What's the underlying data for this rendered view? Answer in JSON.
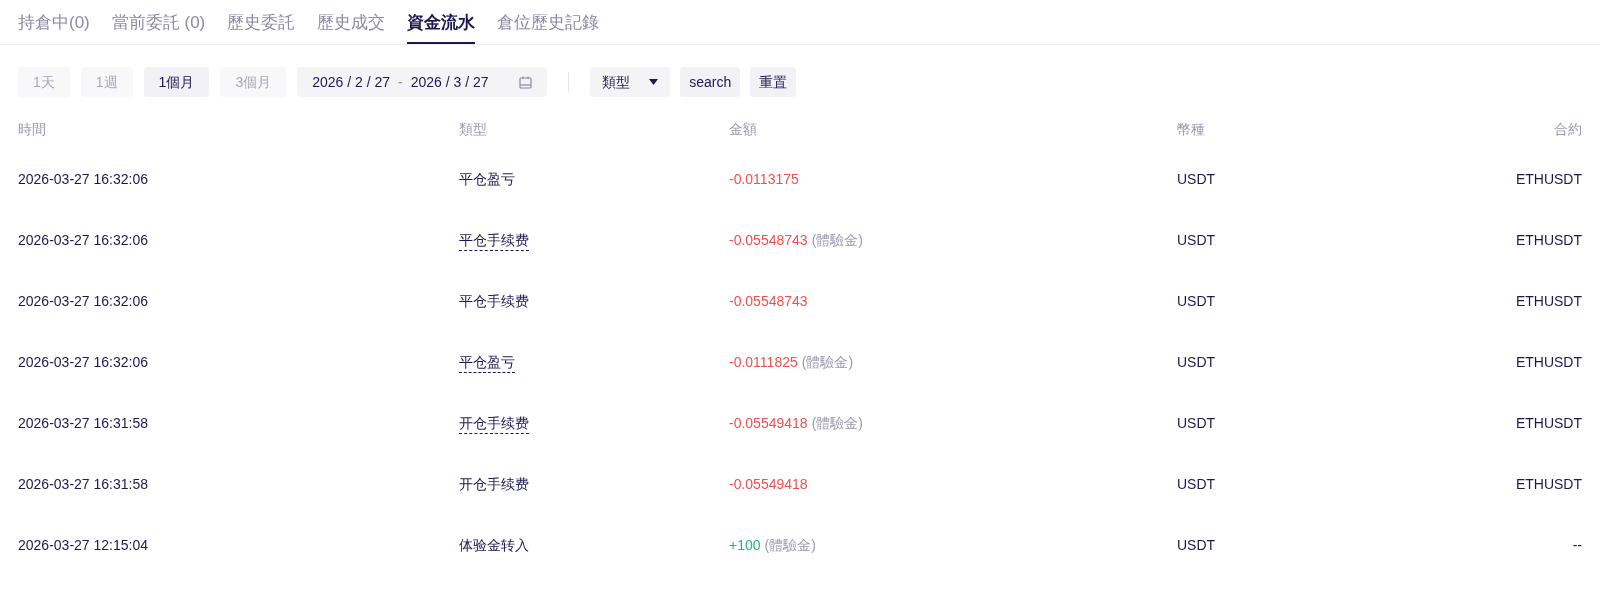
{
  "tabs": [
    {
      "label": "持倉中(0)",
      "selected": false
    },
    {
      "label": "當前委託 (0)",
      "selected": false
    },
    {
      "label": "歷史委託",
      "selected": false
    },
    {
      "label": "歷史成交",
      "selected": false
    },
    {
      "label": "資金流水",
      "selected": true
    },
    {
      "label": "倉位歷史記錄",
      "selected": false
    }
  ],
  "periods": [
    {
      "label": "1天",
      "selected": false
    },
    {
      "label": "1週",
      "selected": false
    },
    {
      "label": "1個月",
      "selected": true
    },
    {
      "label": "3個月",
      "selected": false
    }
  ],
  "date_range": {
    "start": "2026 / 2 / 27",
    "separator": "-",
    "end": "2026 / 3 / 27"
  },
  "type_filter": {
    "label": "類型"
  },
  "buttons": [
    "search",
    "重置"
  ],
  "table": {
    "columns": [
      "時間",
      "類型",
      "金額",
      "幣種",
      "合約"
    ],
    "rows": [
      {
        "time": "2026-03-27 16:32:06",
        "type": "平仓盈亏",
        "dashed": false,
        "amount": "-0.0113175",
        "color": "#f0504f",
        "note": null,
        "currency": "USDT",
        "contract": "ETHUSDT"
      },
      {
        "time": "2026-03-27 16:32:06",
        "type": "平仓手续费",
        "dashed": true,
        "amount": "-0.05548743",
        "color": "#f0504f",
        "note": "(體驗金)",
        "currency": "USDT",
        "contract": "ETHUSDT"
      },
      {
        "time": "2026-03-27 16:32:06",
        "type": "平仓手续费",
        "dashed": false,
        "amount": "-0.05548743",
        "color": "#f0504f",
        "note": null,
        "currency": "USDT",
        "contract": "ETHUSDT"
      },
      {
        "time": "2026-03-27 16:32:06",
        "type": "平仓盈亏",
        "dashed": true,
        "amount": "-0.0111825",
        "color": "#f0504f",
        "note": "(體驗金)",
        "currency": "USDT",
        "contract": "ETHUSDT"
      },
      {
        "time": "2026-03-27 16:31:58",
        "type": "开仓手续费",
        "dashed": true,
        "amount": "-0.05549418",
        "color": "#f0504f",
        "note": "(體驗金)",
        "currency": "USDT",
        "contract": "ETHUSDT"
      },
      {
        "time": "2026-03-27 16:31:58",
        "type": "开仓手续费",
        "dashed": false,
        "amount": "-0.05549418",
        "color": "#f0504f",
        "note": null,
        "currency": "USDT",
        "contract": "ETHUSDT"
      },
      {
        "time": "2026-03-27 12:15:04",
        "type": "体验金转入",
        "dashed": false,
        "amount": "+100",
        "color": "#1fb87c",
        "note": "(體驗金)",
        "currency": "USDT",
        "contract": "--"
      }
    ]
  }
}
